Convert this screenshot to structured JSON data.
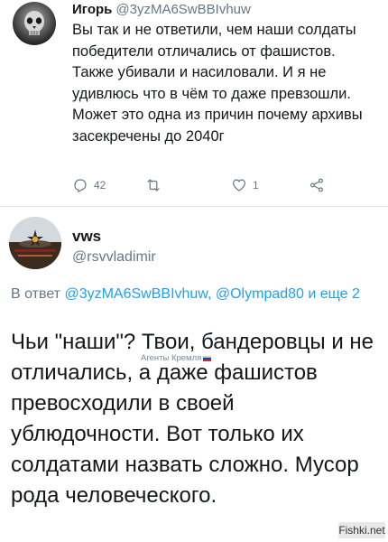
{
  "reply_tweet": {
    "author_name": "Игорь",
    "author_handle": "@3yzMA6SwBBIvhuw",
    "text": "Вы так и не ответили, чем наши солдаты победители отличались от фашистов. Также убивали и насиловали. И я не удивлюсь что в чём то даже превзошли. Может это одна из причин почему архивы засекречены до 2040г",
    "actions": {
      "reply_count": "42",
      "retweet_count": "",
      "like_count": "1"
    }
  },
  "main_tweet": {
    "author_name": "vws",
    "author_handle": "@rsvvladimir",
    "reply_prefix": "В ответ ",
    "reply_mentions": "@3yzMA6SwBBIvhuw, @Olympad80",
    "reply_suffix": " и еще 2",
    "text": "Чьи \"наши\"? Твои, бандеровцы и не отличались, а даже фашистов превосходили в своей ублюдочности. Вот только их солдатами назвать сложно. Мусор рода человеческого."
  },
  "overlay": {
    "agent_label": "Агенты Кремля",
    "site_watermark": "Fishki.net"
  },
  "colors": {
    "text": "#14171a",
    "secondary": "#657786",
    "link": "#1da1f2",
    "divider": "#e1e8ed"
  }
}
